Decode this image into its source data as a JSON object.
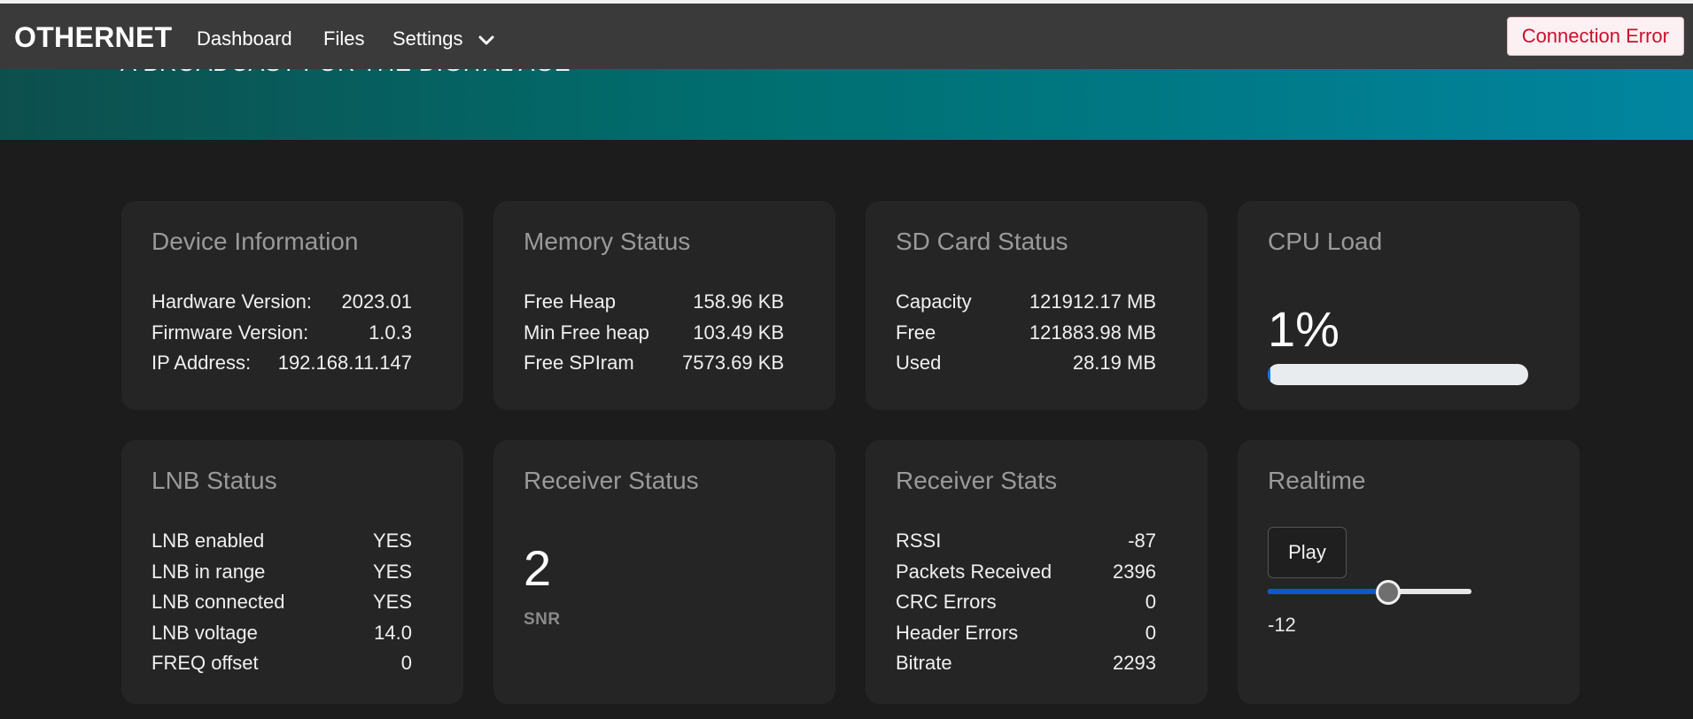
{
  "navbar": {
    "brand": "OTHERNET",
    "links": {
      "dashboard": "Dashboard",
      "files": "Files",
      "settings": "Settings"
    },
    "connection_status": "Connection Error"
  },
  "hero": {
    "tagline": "A BROADCAST FOR THE DIGITAL AGE"
  },
  "device_information": {
    "title": "Device Information",
    "rows": [
      {
        "label": "Hardware Version:",
        "value": "2023.01"
      },
      {
        "label": "Firmware Version:",
        "value": "1.0.3"
      },
      {
        "label": "IP Address:",
        "value": "192.168.11.147"
      }
    ]
  },
  "memory_status": {
    "title": "Memory Status",
    "rows": [
      {
        "label": "Free Heap",
        "value": "158.96 KB"
      },
      {
        "label": "Min Free heap",
        "value": "103.49 KB"
      },
      {
        "label": "Free SPIram",
        "value": "7573.69 KB"
      }
    ]
  },
  "sd_card_status": {
    "title": "SD Card Status",
    "rows": [
      {
        "label": "Capacity",
        "value": "121912.17 MB"
      },
      {
        "label": "Free",
        "value": "121883.98 MB"
      },
      {
        "label": "Used",
        "value": "28.19 MB"
      }
    ]
  },
  "cpu_load": {
    "title": "CPU Load",
    "value": "1%",
    "percent": 1
  },
  "lnb_status": {
    "title": "LNB Status",
    "rows": [
      {
        "label": "LNB enabled",
        "value": "YES"
      },
      {
        "label": "LNB in range",
        "value": "YES"
      },
      {
        "label": "LNB connected",
        "value": "YES"
      },
      {
        "label": "LNB voltage",
        "value": "14.0"
      },
      {
        "label": "FREQ offset",
        "value": "0"
      }
    ]
  },
  "receiver_status": {
    "title": "Receiver Status",
    "value": "2",
    "label": "SNR"
  },
  "receiver_stats": {
    "title": "Receiver Stats",
    "rows": [
      {
        "label": "RSSI",
        "value": "-87"
      },
      {
        "label": "Packets Received",
        "value": "2396"
      },
      {
        "label": "CRC Errors",
        "value": "0"
      },
      {
        "label": "Header Errors",
        "value": "0"
      },
      {
        "label": "Bitrate",
        "value": "2293"
      }
    ]
  },
  "realtime": {
    "title": "Realtime",
    "play_label": "Play",
    "slider_fraction": 0.59,
    "value": "-12"
  },
  "colors": {
    "navbar": "#3a3a3a",
    "background": "#1c1c1c",
    "card": "#252525",
    "accent": "#0d6efd",
    "error": "#c8102e"
  }
}
